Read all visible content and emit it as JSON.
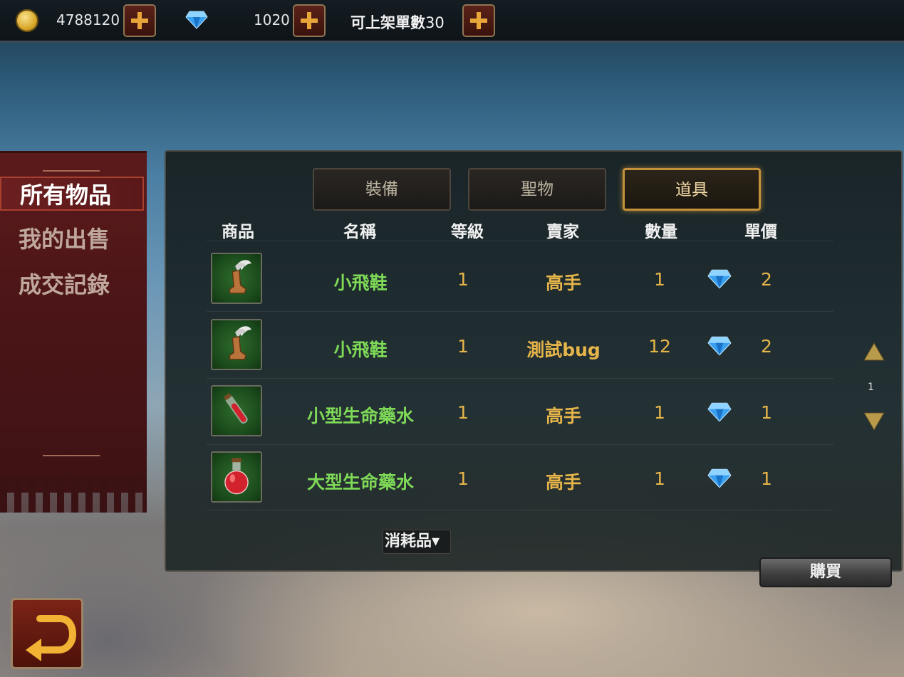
{
  "topbar": {
    "gold_amount": "4788120",
    "diamond_amount": "1020",
    "listing_label": "可上架單數",
    "listing_count": "30"
  },
  "sidebar": {
    "items": [
      {
        "label": "所有物品",
        "active": true
      },
      {
        "label": "我的出售",
        "active": false
      },
      {
        "label": "成交記錄",
        "active": false
      }
    ]
  },
  "tabs": [
    {
      "label": "裝備",
      "active": false
    },
    {
      "label": "聖物",
      "active": false
    },
    {
      "label": "道具",
      "active": true
    }
  ],
  "table": {
    "headers": [
      "商品",
      "名稱",
      "等級",
      "賣家",
      "數量",
      "單價"
    ],
    "rows": [
      {
        "icon": "winged-boots-icon",
        "name": "小飛鞋",
        "level": "1",
        "seller": "高手",
        "quantity": "1",
        "price": "2"
      },
      {
        "icon": "winged-boots-icon",
        "name": "小飛鞋",
        "level": "1",
        "seller": "測試bug",
        "quantity": "12",
        "price": "2"
      },
      {
        "icon": "small-potion-icon",
        "name": "小型生命藥水",
        "level": "1",
        "seller": "高手",
        "quantity": "1",
        "price": "1"
      },
      {
        "icon": "large-potion-icon",
        "name": "大型生命藥水",
        "level": "1",
        "seller": "高手",
        "quantity": "1",
        "price": "1"
      }
    ]
  },
  "pagination": {
    "page": "1"
  },
  "filter": {
    "label": "消耗品▾"
  },
  "buy_button": {
    "label": "購買"
  },
  "colors": {
    "item_name": "#7ed957",
    "value": "#e6b54a",
    "tab_active_border": "#c4913a"
  }
}
